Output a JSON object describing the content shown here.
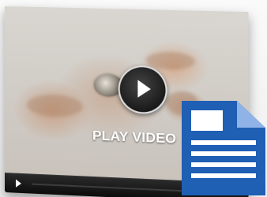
{
  "player": {
    "overlay_label": "PLAY VIDEO"
  },
  "icons": {
    "center_play": "play-icon",
    "control_play": "play-icon",
    "document": "document-icon"
  },
  "colors": {
    "document_blue": "#1f5fb4",
    "control_bar": "#111111",
    "overlay_text": "#ffffff"
  }
}
